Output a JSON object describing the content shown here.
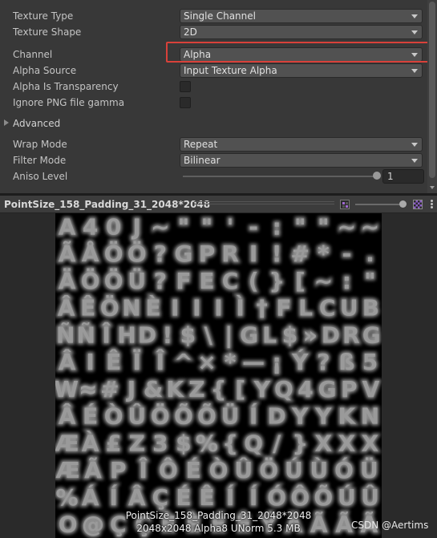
{
  "inspector": {
    "texture_type": {
      "label": "Texture Type",
      "value": "Single Channel"
    },
    "texture_shape": {
      "label": "Texture Shape",
      "value": "2D"
    },
    "channel": {
      "label": "Channel",
      "value": "Alpha"
    },
    "alpha_source": {
      "label": "Alpha Source",
      "value": "Input Texture Alpha"
    },
    "alpha_is_transparency": {
      "label": "Alpha Is Transparency",
      "checked": false
    },
    "ignore_png_gamma": {
      "label": "Ignore PNG file gamma",
      "checked": false
    },
    "advanced": {
      "label": "Advanced",
      "expanded": false
    },
    "wrap_mode": {
      "label": "Wrap Mode",
      "value": "Repeat"
    },
    "filter_mode": {
      "label": "Filter Mode",
      "value": "Bilinear"
    },
    "aniso_level": {
      "label": "Aniso Level",
      "value": "1"
    }
  },
  "preview": {
    "title": "PointSize_158_Padding_31_2048*2048",
    "caption_name": "PointSize_158_Padding_31_2048*2048",
    "caption_info": "2048x2048  Alpha8 UNorm   5.3 MB",
    "icons": [
      "mipmap-icon",
      "mip-level-slider",
      "alpha-channel-icon",
      "more-options-icon"
    ]
  },
  "atlas_rows": [
    "A40J~\"\"'-:\"\"~~",
    "ÃÅÖÖ?GPRI!#*-.",
    "ÄÖÖÜ?FEC(}[~:\"",
    "ÂÊÖNÈIIIÌ†FLCUB",
    "ÑÑÎHD!$\\|GL$»DRG",
    "ÂIÊÏÎ^×*—¡Ý?ß5",
    "W≈#J&KZ{[YQ4GPV",
    "ÂÉÒÛÖÕÕÜÍDYYKN",
    "ÆÀ£Z3$%{Q/}XXX",
    "ÆÃPÎÔÉÒÛÖÚÙÓÜ",
    "%ÁÍÂÇÉÊÍÍÓÔÕÚÛ",
    "O@ÇÇÈÈÉÊÝĀÃÃÃ"
  ],
  "colors": {
    "highlight_box": "#d9413a",
    "glyph_glow": "#bdbdbd"
  },
  "watermark": "CSDN @Aertims"
}
